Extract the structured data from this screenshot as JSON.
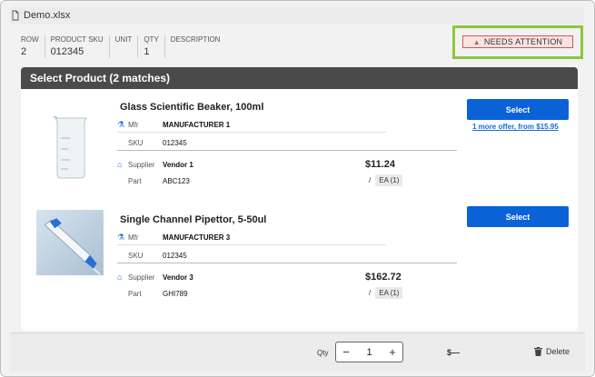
{
  "file": {
    "name": "Demo.xlsx",
    "icon": "file-icon"
  },
  "line": {
    "columns": [
      {
        "header": "ROW",
        "value": "2"
      },
      {
        "header": "PRODUCT SKU",
        "value": "012345"
      },
      {
        "header": "UNIT",
        "value": ""
      },
      {
        "header": "QTY",
        "value": "1"
      },
      {
        "header": "DESCRIPTION",
        "value": ""
      }
    ],
    "status": "NEEDS ATTENTION",
    "status_color": "#d9534f",
    "highlight_color": "#8dc63f"
  },
  "panel": {
    "title": "Select Product (2 matches)"
  },
  "products": [
    {
      "title": "Glass Scientific Beaker, 100ml",
      "mfr_label": "Mfr",
      "mfr": "MANUFACTURER 1",
      "sku_label": "SKU",
      "sku": "012345",
      "supplier_label": "Supplier",
      "supplier": "Vendor 1",
      "part_label": "Part",
      "part": "ABC123",
      "price": "$11.24",
      "uom_slash": "/",
      "uom": "EA (1)",
      "select_label": "Select",
      "more_offers": "1 more offer, from $15.95"
    },
    {
      "title": "Single Channel Pipettor, 5-50ul",
      "mfr_label": "Mfr",
      "mfr": "MANUFACTURER 3",
      "sku_label": "SKU",
      "sku": "012345",
      "supplier_label": "Supplier",
      "supplier": "Vendor 3",
      "part_label": "Part",
      "part": "GHI789",
      "price": "$162.72",
      "uom_slash": "/",
      "uom": "EA (1)",
      "select_label": "Select"
    }
  ],
  "footer": {
    "qty_label": "Qty",
    "qty_value": "1",
    "minus": "−",
    "plus": "+",
    "total": "$—",
    "delete_label": "Delete"
  },
  "colors": {
    "primary": "#0a62d6",
    "header_bg": "#4a4a4a"
  }
}
